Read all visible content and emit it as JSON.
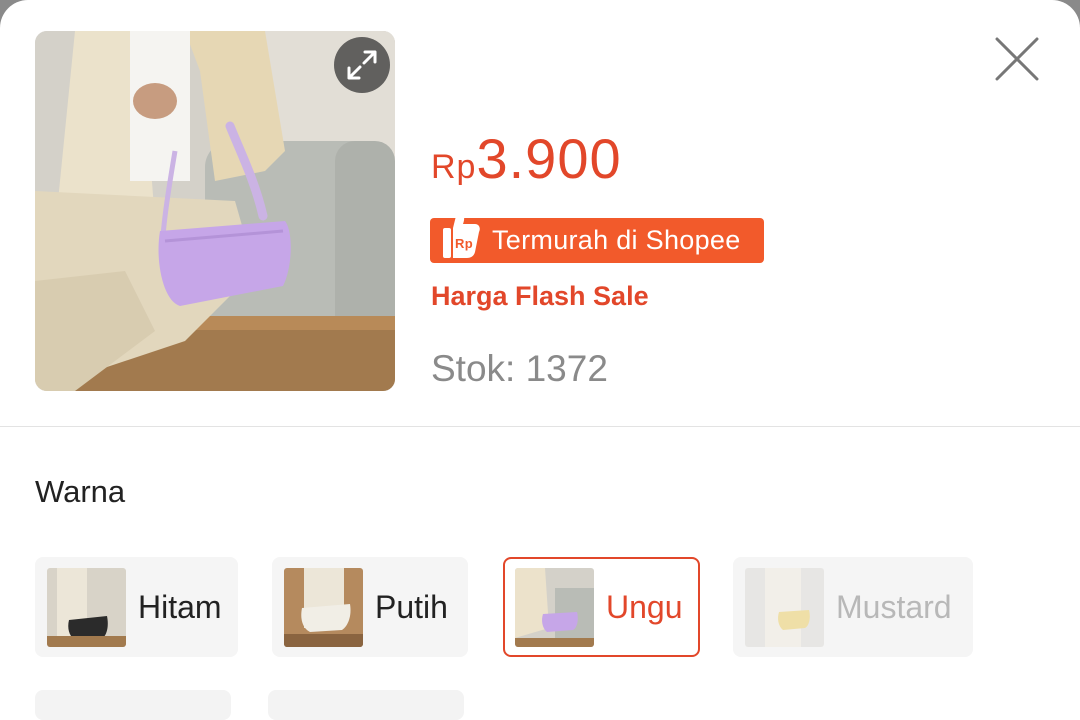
{
  "product": {
    "price_currency": "Rp",
    "price_amount": "3.900",
    "badge_label": "Termurah di Shopee",
    "badge_icon_text": "Rp",
    "flash_sale_label": "Harga Flash Sale",
    "stock_text": "Stok: 1372"
  },
  "variants_section": {
    "title": "Warna",
    "options": [
      {
        "label": "Hitam",
        "state": "normal",
        "bag_color": "#2b2b2b"
      },
      {
        "label": "Putih",
        "state": "normal",
        "bag_color": "#f1eee6"
      },
      {
        "label": "Ungu",
        "state": "selected",
        "bag_color": "#c6a6e8"
      },
      {
        "label": "Mustard",
        "state": "disabled",
        "bag_color": "#e8c64a"
      }
    ]
  },
  "colors": {
    "accent": "#e2472a",
    "badge_bg": "#f25a2b",
    "stock_text": "#8a8a8a"
  },
  "icons": {
    "expand": "expand-arrows-icon",
    "close": "close-icon",
    "badge": "thumbs-up-rp-icon"
  }
}
